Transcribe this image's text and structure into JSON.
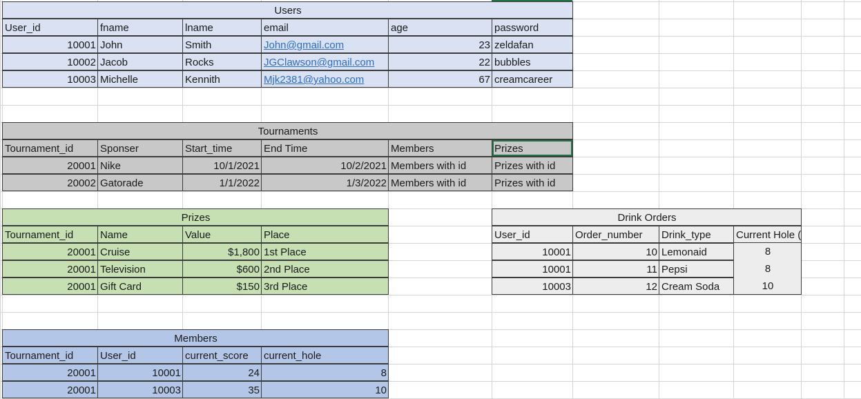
{
  "colors": {
    "users_bg": "#d9e1f2",
    "tournaments_bg": "#c8c8c8",
    "prizes_bg": "#c6e0b4",
    "drink_orders_bg": "#ededed",
    "members_bg": "#b4c6e7",
    "gridline": "#d4d4d4",
    "link": "#2f6fc1",
    "selection": "#217346"
  },
  "users": {
    "title": "Users",
    "headers": [
      "User_id",
      "fname",
      "lname",
      "email",
      "age",
      "password"
    ],
    "rows": [
      [
        "10001",
        "John",
        "Smith",
        "John@gmail.com",
        "23",
        "zeldafan"
      ],
      [
        "10002",
        "Jacob",
        "Rocks",
        "JGClawson@gmail.com",
        "22",
        "bubbles"
      ],
      [
        "10003",
        "Michelle",
        "Kennith",
        "Mjk2381@yahoo.com",
        "67",
        "creamcareer"
      ]
    ]
  },
  "tournaments": {
    "title": "Tournaments",
    "headers": [
      "Tournament_id",
      "Sponser",
      "Start_time",
      "End Time",
      "Members",
      "Prizes"
    ],
    "rows": [
      [
        "20001",
        "Nike",
        "10/1/2021",
        "10/2/2021",
        "Members with id",
        "Prizes with id"
      ],
      [
        "20002",
        "Gatorade",
        "1/1/2022",
        "1/3/2022",
        "Members with id",
        "Prizes with id"
      ]
    ]
  },
  "prizes": {
    "title": "Prizes",
    "headers": [
      "Tournament_id",
      "Name",
      "Value",
      "Place"
    ],
    "rows": [
      [
        "20001",
        "Cruise",
        "$1,800",
        "1st Place"
      ],
      [
        "20001",
        "Television",
        "$600",
        "2nd Place"
      ],
      [
        "20001",
        "Gift Card",
        "$150",
        "3rd Place"
      ]
    ]
  },
  "drink_orders": {
    "title": "Drink Orders",
    "headers": [
      "User_id",
      "Order_number",
      "Drink_type",
      "Current Hole (optional)"
    ],
    "rows": [
      [
        "10001",
        "10",
        "Lemonaid",
        "8"
      ],
      [
        "10001",
        "11",
        "Pepsi",
        "8"
      ],
      [
        "10003",
        "12",
        "Cream Soda",
        "10"
      ]
    ]
  },
  "members": {
    "title": "Members",
    "headers": [
      "Tournament_id",
      "User_id",
      "current_score",
      "current_hole"
    ],
    "rows": [
      [
        "20001",
        "10001",
        "24",
        "8"
      ],
      [
        "20001",
        "10003",
        "35",
        "10"
      ]
    ]
  }
}
